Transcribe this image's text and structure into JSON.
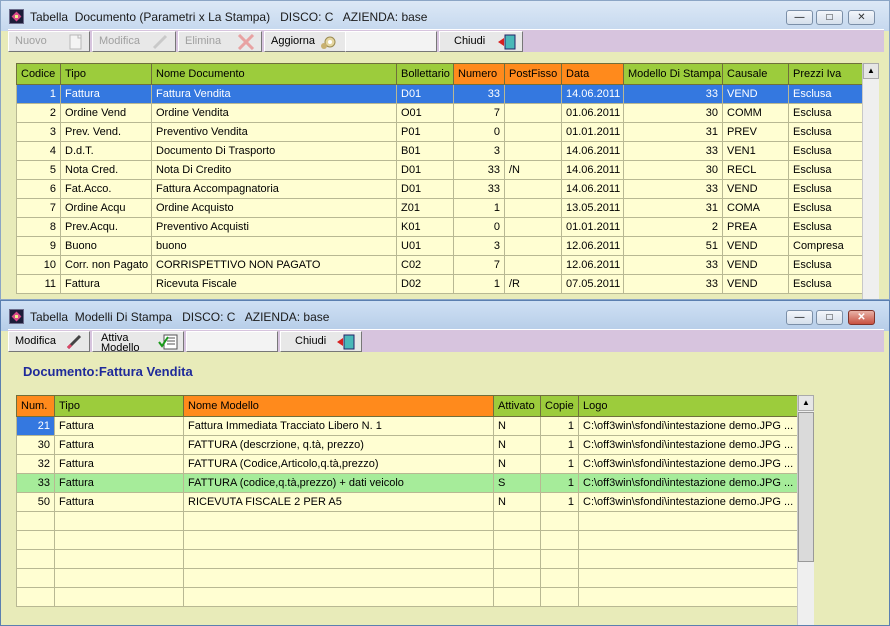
{
  "window1": {
    "title": "Tabella  Documento (Parametri x La Stampa)   DISCO: C   AZIENDA: base",
    "toolbar": {
      "nuovo": "Nuovo",
      "modifica": "Modifica",
      "elimina": "Elimina",
      "aggiorna": "Aggiorna",
      "chiudi": "Chiudi"
    },
    "columns": [
      "Codice",
      "Tipo",
      "Nome Documento",
      "Bollettario",
      "Numero",
      "PostFisso",
      "Data",
      "Modello Di Stampa",
      "Causale",
      "Prezzi Iva"
    ],
    "rows": [
      [
        "1",
        "Fattura",
        "Fattura Vendita",
        "D01",
        "33",
        "",
        "14.06.2011",
        "33",
        "VEND",
        "Esclusa"
      ],
      [
        "2",
        "Ordine Vend",
        "Ordine Vendita",
        "O01",
        "7",
        "",
        "01.06.2011",
        "30",
        "COMM",
        "Esclusa"
      ],
      [
        "3",
        "Prev. Vend.",
        "Preventivo Vendita",
        "P01",
        "0",
        "",
        "01.01.2011",
        "31",
        "PREV",
        "Esclusa"
      ],
      [
        "4",
        "D.d.T.",
        "Documento Di Trasporto",
        "B01",
        "3",
        "",
        "14.06.2011",
        "33",
        "VEN1",
        "Esclusa"
      ],
      [
        "5",
        "Nota Cred.",
        "Nota Di Credito",
        "D01",
        "33",
        "/N",
        "14.06.2011",
        "30",
        "RECL",
        "Esclusa"
      ],
      [
        "6",
        "Fat.Acco.",
        "Fattura Accompagnatoria",
        "D01",
        "33",
        "",
        "14.06.2011",
        "33",
        "VEND",
        "Esclusa"
      ],
      [
        "7",
        "Ordine Acqu",
        "Ordine Acquisto",
        "Z01",
        "1",
        "",
        "13.05.2011",
        "31",
        "COMA",
        "Esclusa"
      ],
      [
        "8",
        "Prev.Acqu.",
        "Preventivo Acquisti",
        "K01",
        "0",
        "",
        "01.01.2011",
        "2",
        "PREA",
        "Esclusa"
      ],
      [
        "9",
        "Buono",
        "buono",
        "U01",
        "3",
        "",
        "12.06.2011",
        "51",
        "VEND",
        "Compresa"
      ],
      [
        "10",
        "Corr. non Pagato",
        "CORRISPETTIVO NON PAGATO",
        "C02",
        "7",
        "",
        "12.06.2011",
        "33",
        "VEND",
        "Esclusa"
      ],
      [
        "11",
        "Fattura",
        "Ricevuta Fiscale",
        "D02",
        "1",
        "/R",
        "07.05.2011",
        "33",
        "VEND",
        "Esclusa"
      ]
    ]
  },
  "window2": {
    "title": "Tabella  Modelli Di Stampa   DISCO: C   AZIENDA: base",
    "toolbar": {
      "modifica": "Modifica",
      "attiva_modello_1": "Attiva",
      "attiva_modello_2": "Modello",
      "chiudi": "Chiudi"
    },
    "document_label": "Documento:Fattura Vendita",
    "columns": [
      "Num.",
      "Tipo",
      "Nome Modello",
      "Attivato",
      "Copie",
      "Logo"
    ],
    "rows": [
      [
        "21",
        "Fattura",
        "Fattura Immediata Tracciato Libero N. 1",
        "N",
        "1",
        "C:\\off3win\\sfondi\\intestazione demo.JPG  ..."
      ],
      [
        "30",
        "Fattura",
        "FATTURA (descrzione, q.tà, prezzo)",
        "N",
        "1",
        "C:\\off3win\\sfondi\\intestazione demo.JPG  ..."
      ],
      [
        "32",
        "Fattura",
        "FATTURA (Codice,Articolo,q.tà,prezzo)",
        "N",
        "1",
        "C:\\off3win\\sfondi\\intestazione demo.JPG  ..."
      ],
      [
        "33",
        "Fattura",
        "FATTURA (codice,q.tà,prezzo) + dati veicolo",
        "S",
        "1",
        "C:\\off3win\\sfondi\\intestazione demo.JPG  ..."
      ],
      [
        "50",
        "Fattura",
        "RICEVUTA FISCALE 2 PER A5",
        "N",
        "1",
        "C:\\off3win\\sfondi\\intestazione demo.JPG  ..."
      ]
    ]
  },
  "window_controls": {
    "minimize": "—",
    "maximize": "□",
    "close": "✕"
  }
}
